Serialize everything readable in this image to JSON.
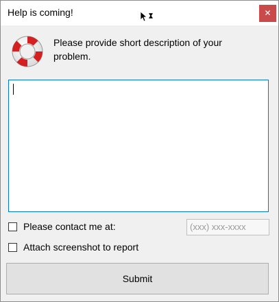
{
  "window": {
    "title": "Help is coming!",
    "close_symbol": "✕"
  },
  "header": {
    "icon": "lifebuoy-icon",
    "prompt": "Please provide short description of your problem."
  },
  "description": {
    "value": ""
  },
  "options": {
    "contact_label": "Please contact me at:",
    "contact_checked": false,
    "phone_placeholder": "(xxx) xxx-xxxx",
    "screenshot_label": "Attach screenshot to report",
    "screenshot_checked": false
  },
  "actions": {
    "submit_label": "Submit"
  },
  "colors": {
    "close_button": "#c94a4a",
    "focus_border": "#0078d7",
    "window_bg": "#f0f0f0"
  }
}
